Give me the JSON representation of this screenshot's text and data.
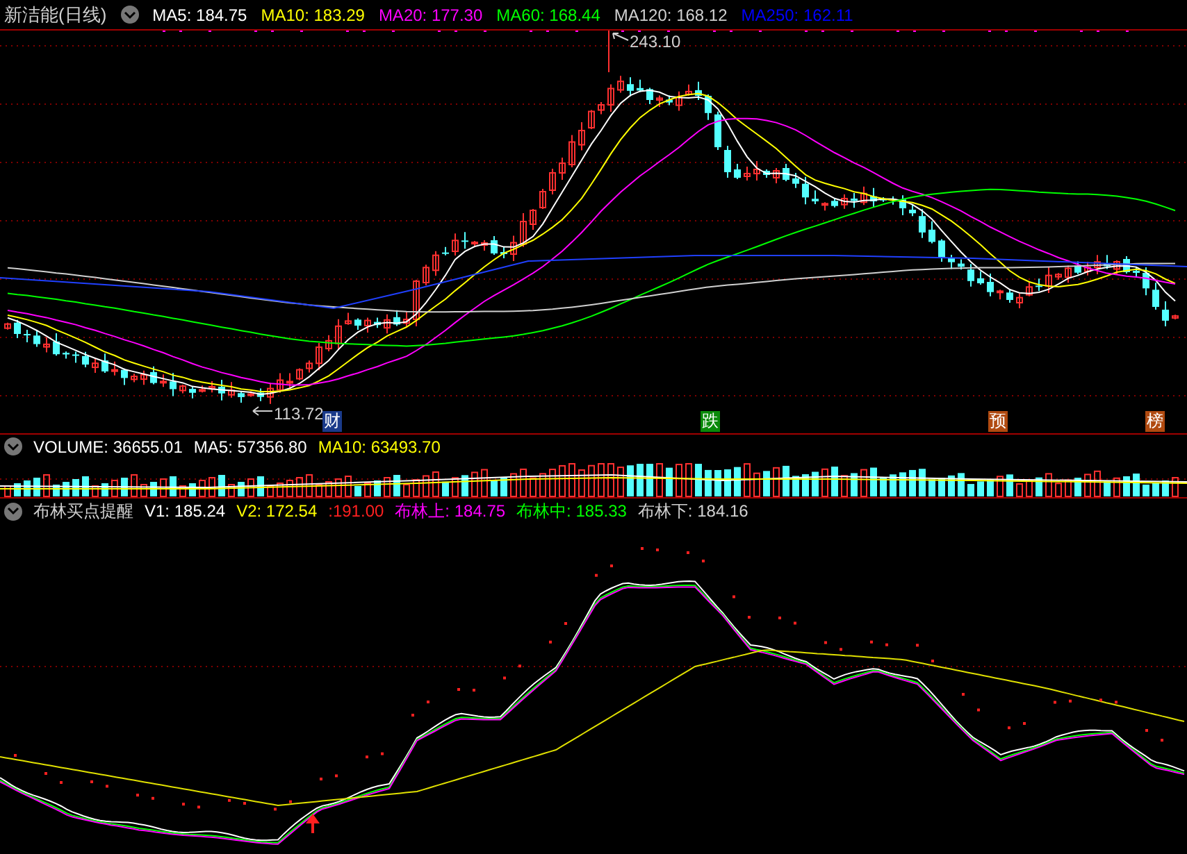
{
  "price_panel": {
    "title": "新洁能(日线)",
    "indicators": [
      {
        "text": "MA5: 184.75",
        "color": "#ffffff"
      },
      {
        "text": "MA10: 183.29",
        "color": "#ffff00"
      },
      {
        "text": "MA20: 177.30",
        "color": "#ff00ff"
      },
      {
        "text": "MA60: 168.44",
        "color": "#00ff00"
      },
      {
        "text": "MA120: 168.12",
        "color": "#d0d0d0"
      },
      {
        "text": "MA250: 162.11",
        "color": "#0000ff"
      }
    ],
    "high_label": "243.10",
    "low_label": "113.72",
    "events": [
      {
        "text": "财",
        "color": "#1a3a8a"
      },
      {
        "text": "跌",
        "color": "#0a8a0a"
      },
      {
        "text": "预",
        "color": "#b04a10"
      },
      {
        "text": "榜",
        "color": "#b04a10"
      }
    ]
  },
  "volume_panel": {
    "indicators": [
      {
        "text": "VOLUME: 36655.01",
        "color": "#ffffff"
      },
      {
        "text": "MA5: 57356.80",
        "color": "#ffffff"
      },
      {
        "text": "MA10: 63493.70",
        "color": "#ffff00"
      }
    ]
  },
  "bollinger_panel": {
    "title": "布林买点提醒",
    "indicators": [
      {
        "text": "V1: 185.24",
        "color": "#ffffff"
      },
      {
        "text": "V2: 172.54",
        "color": "#ffff00"
      },
      {
        "text": ":191.00",
        "color": "#ff2020"
      },
      {
        "text": "布林上: 184.75",
        "color": "#ff00ff"
      },
      {
        "text": "布林中: 185.33",
        "color": "#00ff00"
      },
      {
        "text": "布林下: 184.16",
        "color": "#d0d0d0"
      }
    ]
  }
}
